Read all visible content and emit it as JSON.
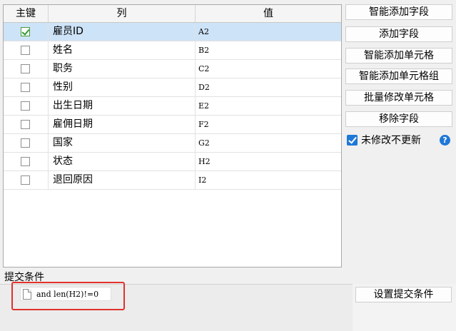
{
  "grid": {
    "headers": {
      "key": "主键",
      "column": "列",
      "value": "值"
    },
    "rows": [
      {
        "key": true,
        "column": "雇员ID",
        "value": "A2"
      },
      {
        "key": false,
        "column": "姓名",
        "value": "B2"
      },
      {
        "key": false,
        "column": "职务",
        "value": "C2"
      },
      {
        "key": false,
        "column": "性别",
        "value": "D2"
      },
      {
        "key": false,
        "column": "出生日期",
        "value": "E2"
      },
      {
        "key": false,
        "column": "雇佣日期",
        "value": "F2"
      },
      {
        "key": false,
        "column": "国家",
        "value": "G2"
      },
      {
        "key": false,
        "column": "状态",
        "value": "H2"
      },
      {
        "key": false,
        "column": "退回原因",
        "value": "I2"
      }
    ],
    "selected_row": 0
  },
  "buttons": {
    "smart_add_field": "智能添加字段",
    "add_field": "添加字段",
    "smart_add_cell": "智能添加单元格",
    "smart_add_cell_group": "智能添加单元格组",
    "batch_edit_cells": "批量修改单元格",
    "remove_field": "移除字段"
  },
  "options": {
    "no_update_unmodified": "未修改不更新",
    "no_update_checked": true,
    "help_icon": "?"
  },
  "submit": {
    "label": "提交条件",
    "condition": "and len(H2)!=0",
    "set_button": "设置提交条件"
  }
}
